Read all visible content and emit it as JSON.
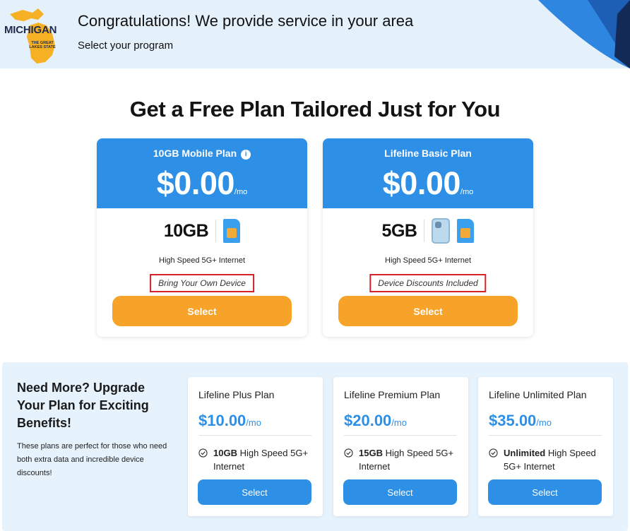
{
  "header": {
    "logo_text": "MICHIGAN",
    "logo_tagline": "THE GREAT LAKES STATE",
    "title": "Congratulations! We provide service in your area",
    "subtitle": "Select your program"
  },
  "main": {
    "title": "Get a Free Plan Tailored Just for You"
  },
  "free_plans": [
    {
      "name": "10GB Mobile Plan",
      "price": "$0.00",
      "period": "/mo",
      "data": "10GB",
      "feature": "High Speed 5G+ Internet",
      "note": "Bring Your Own Device",
      "select_label": "Select",
      "icons": [
        "sim-card-icon"
      ]
    },
    {
      "name": "Lifeline Basic Plan",
      "price": "$0.00",
      "period": "/mo",
      "data": "5GB",
      "feature": "High Speed 5G+ Internet",
      "note": "Device Discounts Included",
      "select_label": "Select",
      "icons": [
        "phone-icon",
        "sim-card-icon"
      ]
    }
  ],
  "upgrade": {
    "title": "Need More? Upgrade Your Plan for Exciting Benefits!",
    "description": "These plans are perfect for those who need both extra data and incredible device discounts!",
    "plans": [
      {
        "name": "Lifeline Plus Plan",
        "price": "$10.00",
        "period": "/mo",
        "feature_bold": "10GB",
        "feature_rest": " High Speed 5G+ Internet",
        "select_label": "Select"
      },
      {
        "name": "Lifeline Premium Plan",
        "price": "$20.00",
        "period": "/mo",
        "feature_bold": "15GB",
        "feature_rest": " High Speed 5G+ Internet",
        "select_label": "Select"
      },
      {
        "name": "Lifeline Unlimited Plan",
        "price": "$35.00",
        "period": "/mo",
        "feature_bold": "Unlimited",
        "feature_rest": " High Speed 5G+ Internet",
        "select_label": "Select"
      }
    ]
  },
  "colors": {
    "primary_blue": "#2e8fe6",
    "select_orange": "#f7a229",
    "note_border_red": "#d3222a",
    "header_bg": "#e4f1fb"
  }
}
